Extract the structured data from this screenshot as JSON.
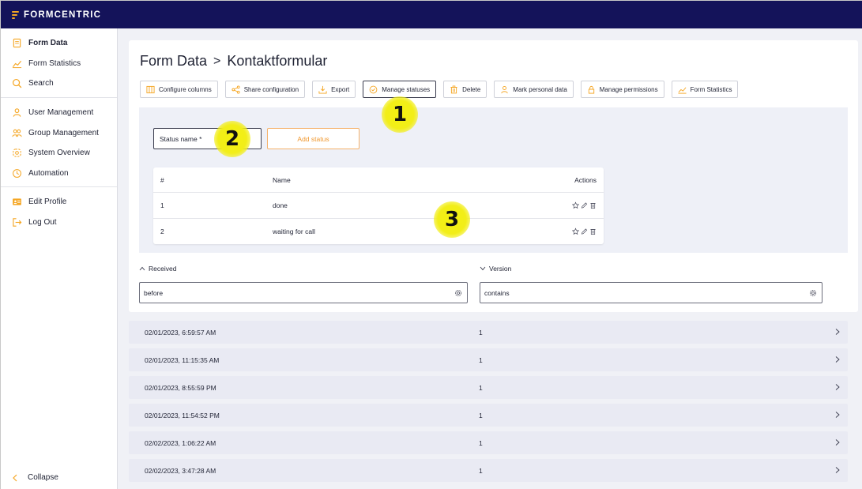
{
  "app": {
    "logo_text": "FORMCENTRIC",
    "brand_color": "#14135a",
    "accent_color": "#f5a623"
  },
  "sidebar": {
    "groups": [
      [
        {
          "label": "Form Data",
          "icon": "document-icon",
          "bold": true
        },
        {
          "label": "Form Statistics",
          "icon": "chart-line-icon"
        },
        {
          "label": "Search",
          "icon": "search-icon"
        }
      ],
      [
        {
          "label": "User Management",
          "icon": "user-icon"
        },
        {
          "label": "Group Management",
          "icon": "group-icon"
        },
        {
          "label": "System Overview",
          "icon": "gear-icon"
        },
        {
          "label": "Automation",
          "icon": "clock-icon"
        }
      ],
      [
        {
          "label": "Edit Profile",
          "icon": "id-card-icon"
        },
        {
          "label": "Log Out",
          "icon": "logout-icon"
        }
      ]
    ],
    "collapse_label": "Collapse"
  },
  "page": {
    "title_root": "Form Data",
    "title_separator": ">",
    "title_form": "Kontaktformular"
  },
  "toolbar": {
    "buttons": [
      {
        "label": "Configure columns",
        "icon": "columns-icon"
      },
      {
        "label": "Share configuration",
        "icon": "share-icon"
      },
      {
        "label": "Export",
        "icon": "download-icon"
      },
      {
        "label": "Manage statuses",
        "icon": "check-circle-icon",
        "active": true
      },
      {
        "label": "Delete",
        "icon": "trash-icon"
      },
      {
        "label": "Mark personal data",
        "icon": "user-icon"
      },
      {
        "label": "Manage permissions",
        "icon": "lock-icon"
      },
      {
        "label": "Form Statistics",
        "icon": "chart-line-icon"
      }
    ]
  },
  "status_panel": {
    "input_placeholder": "Status name *",
    "add_label": "Add status",
    "table": {
      "headers": {
        "index": "#",
        "name": "Name",
        "actions": "Actions"
      },
      "rows": [
        {
          "index": "1",
          "name": "done"
        },
        {
          "index": "2",
          "name": "waiting for call"
        }
      ]
    }
  },
  "filters": {
    "received": {
      "label": "Received",
      "value": "before"
    },
    "version": {
      "label": "Version",
      "value": "contains"
    }
  },
  "data_rows": [
    {
      "date": "02/01/2023, 6:59:57 AM",
      "version": "1"
    },
    {
      "date": "02/01/2023, 11:15:35 AM",
      "version": "1"
    },
    {
      "date": "02/01/2023, 8:55:59 PM",
      "version": "1"
    },
    {
      "date": "02/01/2023, 11:54:52 PM",
      "version": "1"
    },
    {
      "date": "02/02/2023, 1:06:22 AM",
      "version": "1"
    },
    {
      "date": "02/02/2023, 3:47:28 AM",
      "version": "1"
    }
  ],
  "annotations": [
    "1",
    "2",
    "3"
  ]
}
